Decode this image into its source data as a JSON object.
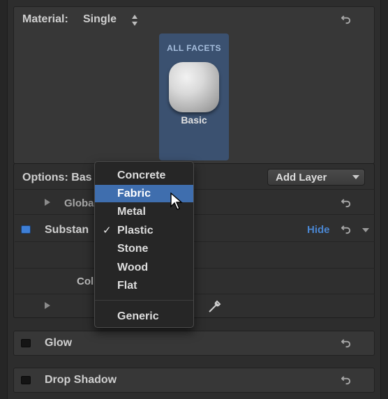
{
  "material": {
    "label": "Material:",
    "value": "Single"
  },
  "facet": {
    "caption": "ALL FACETS",
    "name": "Basic"
  },
  "options": {
    "label": "Options: Bas",
    "add_layer": "Add Layer"
  },
  "rows": {
    "global": "Globa",
    "substance": "Substan",
    "substance_hide": "Hide",
    "col": "Col"
  },
  "menu": {
    "items": [
      "Concrete",
      "Fabric",
      "Metal",
      "Plastic",
      "Stone",
      "Wood",
      "Flat"
    ],
    "generic": "Generic",
    "checked": "Plastic",
    "highlighted": "Fabric"
  },
  "glow": {
    "label": "Glow"
  },
  "drop_shadow": {
    "label": "Drop Shadow"
  },
  "colors": {
    "accent": "#3f6eae",
    "tile": "#3b5170",
    "hide_link": "#4a86d1"
  }
}
